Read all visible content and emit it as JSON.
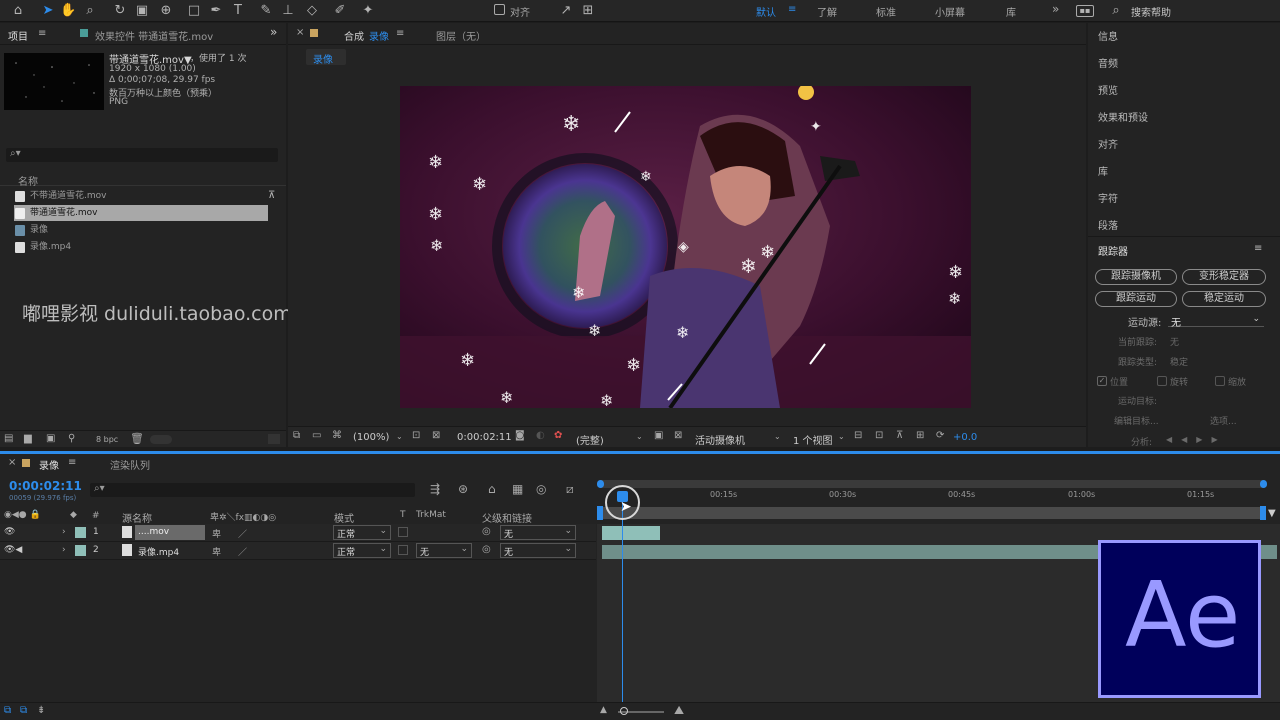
{
  "toolbar": {
    "align_label": "对齐",
    "workspaces": [
      "默认",
      "了解",
      "标准",
      "小屏幕",
      "库"
    ],
    "search_help": "搜索帮助"
  },
  "project": {
    "tab_project": "项目",
    "tab_effects": "效果控件 带通道雪花.mov",
    "file_name": "带通道雪花.mov▼",
    "used_count": "，使用了 1 次",
    "resolution": "1920 x 1080 (1.00)",
    "duration": "Δ 0;00;07;08, 29.97 fps",
    "color_info": "数百万种以上颜色（预乘）",
    "format": "PNG",
    "name_header": "名称",
    "items": [
      "不带通道雪花.mov",
      "带通道雪花.mov",
      "录像",
      "录像.mp4"
    ],
    "bpc": "8 bpc"
  },
  "watermark": "嘟哩影视 duliduli.taobao.com",
  "composition": {
    "tab_comp_prefix": "合成",
    "tab_comp_name": "录像",
    "tab_layer": "图层（无）",
    "subtab": "录像",
    "zoom": "(100%)",
    "timecode": "0:00:02:11",
    "resolution": "(完整)",
    "camera": "活动摄像机",
    "views": "1 个视图",
    "exposure": "+0.0"
  },
  "right_panel": {
    "items": [
      "信息",
      "音频",
      "预览",
      "效果和预设",
      "对齐",
      "库",
      "字符",
      "段落"
    ],
    "tracker_title": "跟踪器",
    "buttons": [
      "跟踪摄像机",
      "变形稳定器",
      "跟踪运动",
      "稳定运动"
    ],
    "motion_source_label": "运动源:",
    "motion_source_value": "无",
    "current_track_label": "当前跟踪:",
    "current_track_value": "无",
    "track_type_label": "跟踪类型:",
    "track_type_value": "稳定",
    "checks": [
      "位置",
      "旋转",
      "缩放"
    ],
    "motion_target": "运动目标:",
    "edit_target": "编辑目标...",
    "options": "选项...",
    "analyze": "分析:"
  },
  "timeline": {
    "tab_name": "录像",
    "tab_render": "渲染队列",
    "timecode": "0:00:02:11",
    "frame_info": "00059 (29.976 fps)",
    "col_hash": "#",
    "col_source": "源名称",
    "col_mode": "模式",
    "col_t": "T",
    "col_trkmat": "TrkMat",
    "col_parent": "父级和链接",
    "ticks": [
      "00:15s",
      "00:30s",
      "00:45s",
      "01:00s",
      "01:15s"
    ],
    "layers": [
      {
        "num": "1",
        "name": "....mov",
        "mode": "正常",
        "trkmat": "",
        "parent": "无"
      },
      {
        "num": "2",
        "name": "录像.mp4",
        "mode": "正常",
        "trkmat": "无",
        "parent": "无"
      }
    ],
    "playhead_fraction": 0.04,
    "layer1_bar_fraction": 0.087
  },
  "ae_logo": "Ae",
  "colors": {
    "accent": "#2d8ceb",
    "ae_purple": "#9999ff",
    "ae_bg": "#00005b",
    "layer_teal": "#8fbfb8"
  }
}
